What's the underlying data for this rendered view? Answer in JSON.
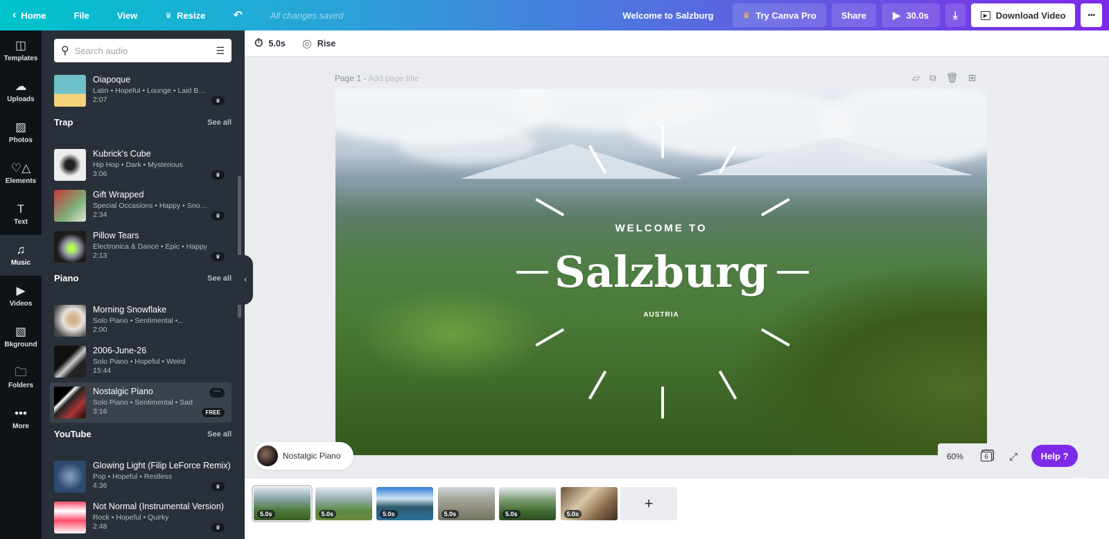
{
  "topbar": {
    "home": "Home",
    "file": "File",
    "view": "View",
    "resize": "Resize",
    "saved_status": "All changes saved",
    "design_title": "Welcome to Salzburg",
    "try_pro": "Try Canva Pro",
    "share": "Share",
    "play_duration": "30.0s",
    "download_video": "Download Video",
    "more": "•••"
  },
  "rail": [
    {
      "label": "Templates",
      "icon": "templates-icon",
      "glyph": "◫"
    },
    {
      "label": "Uploads",
      "icon": "cloud-upload-icon",
      "glyph": "☁"
    },
    {
      "label": "Photos",
      "icon": "image-icon",
      "glyph": "▨"
    },
    {
      "label": "Elements",
      "icon": "shapes-icon",
      "glyph": "♡△"
    },
    {
      "label": "Text",
      "icon": "text-icon",
      "glyph": "T"
    },
    {
      "label": "Music",
      "icon": "music-note-icon",
      "glyph": "♫",
      "active": true
    },
    {
      "label": "Videos",
      "icon": "video-icon",
      "glyph": "▶"
    },
    {
      "label": "Bkground",
      "icon": "background-pattern-icon",
      "glyph": "▧"
    },
    {
      "label": "Folders",
      "icon": "folder-icon",
      "glyph": "🗀"
    },
    {
      "label": "More",
      "icon": "more-dots-icon",
      "glyph": "•••"
    }
  ],
  "panel": {
    "search_placeholder": "Search audio",
    "sections": [
      {
        "title": "",
        "see_all": "",
        "tracks": [
          {
            "name": "Oiapoque",
            "tags": "Latin • Hopeful • Lounge • Laid Back",
            "duration": "2:07",
            "badge": "crown"
          }
        ]
      },
      {
        "title": "Trap",
        "see_all": "See all",
        "tracks": [
          {
            "name": "Kubrick's Cube",
            "tags": "Hip Hop • Dark • Mysterious",
            "duration": "3:06",
            "badge": "crown"
          },
          {
            "name": "Gift Wrapped",
            "tags": "Special Occasions • Happy • Snow...",
            "duration": "2:34",
            "badge": "crown"
          },
          {
            "name": "Pillow Tears",
            "tags": "Electronica & Dance • Epic • Happy",
            "duration": "2:13",
            "badge": "crown"
          }
        ]
      },
      {
        "title": "Piano",
        "see_all": "See all",
        "tracks": [
          {
            "name": "Morning Snowflake",
            "tags": "Solo Piano • Sentimental •...",
            "duration": "2:00",
            "badge": ""
          },
          {
            "name": "2006-June-26",
            "tags": "Solo Piano • Hopeful • Weird",
            "duration": "15:44",
            "badge": ""
          },
          {
            "name": "Nostalgic Piano",
            "tags": "Solo Piano • Sentimental • Sad",
            "duration": "3:16",
            "badge": "FREE",
            "selected": true
          }
        ]
      },
      {
        "title": "YouTube",
        "see_all": "See all",
        "tracks": [
          {
            "name": "Glowing Light (Filip LeForce Remix)",
            "tags": "Pop • Hopeful • Restless",
            "duration": "4:36",
            "badge": "crown"
          },
          {
            "name": "Not Normal (Instrumental Version)",
            "tags": "Rock • Hopeful • Quirky",
            "duration": "2:48",
            "badge": "crown"
          }
        ]
      }
    ]
  },
  "editor_toolbar": {
    "duration": "5.0s",
    "animation": "Rise"
  },
  "page": {
    "label": "Page 1 -",
    "title_placeholder": "Add page title"
  },
  "canvas": {
    "welcome": "WELCOME TO",
    "title": "Salzburg",
    "subtitle": "AUSTRIA"
  },
  "audio_pill": {
    "track": "Nostalgic Piano"
  },
  "zoom": {
    "level": "60%",
    "page_count": "6"
  },
  "help": "Help ?",
  "timeline": {
    "slides": [
      {
        "duration": "5.0s",
        "selected": true
      },
      {
        "duration": "5.0s"
      },
      {
        "duration": "5.0s"
      },
      {
        "duration": "5.0s"
      },
      {
        "duration": "5.0s"
      },
      {
        "duration": "5.0s"
      }
    ],
    "add": "+"
  }
}
